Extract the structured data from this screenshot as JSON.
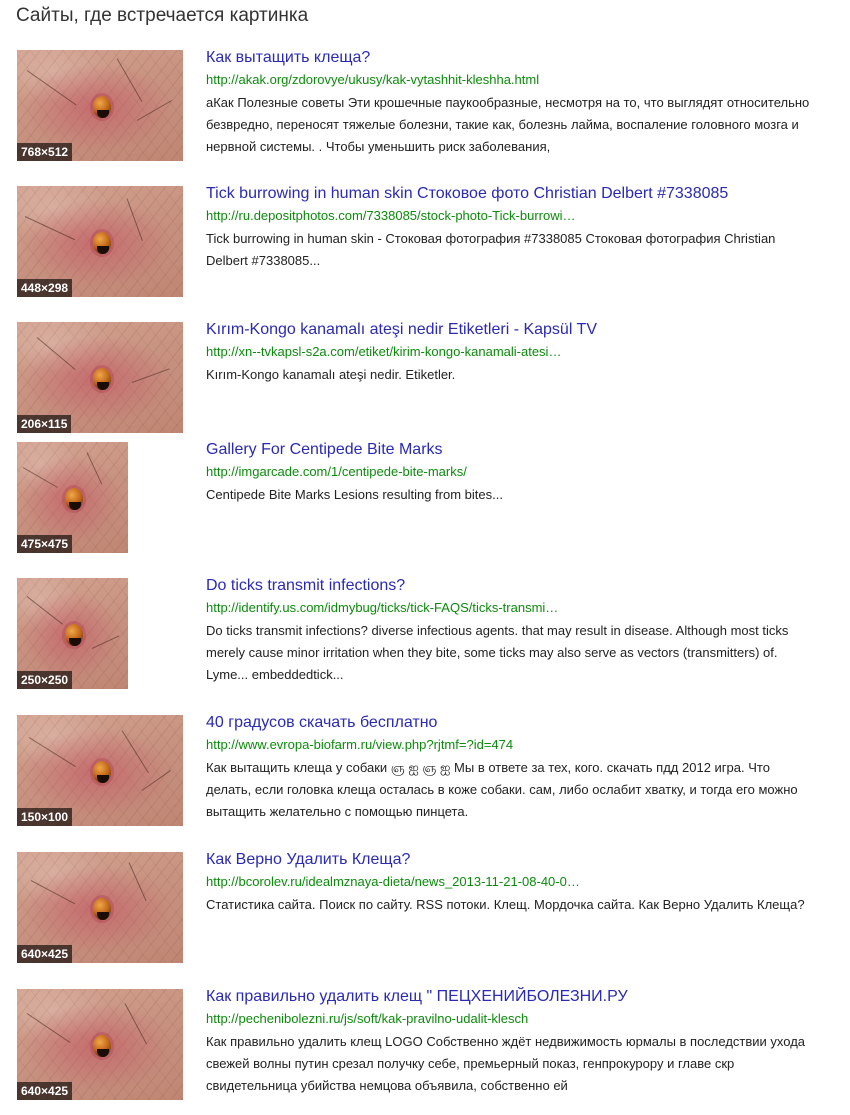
{
  "page_title": "Сайты, где встречается картинка",
  "results": [
    {
      "size": "768×512",
      "title": "Как вытащить клеща?",
      "url": "http://akak.org/zdorovye/ukusy/kak-vytashhit-kleshha.html",
      "snippet": "аКак Полезные советы Эти крошечные паукообразные, несмотря на то, что выглядят относительно безвредно, переносят тяжелые болезни, такие как, болезнь лайма, воспаление головного мозга и нервной системы. . Чтобы уменьшить риск заболевания,"
    },
    {
      "size": "448×298",
      "title": "Tick burrowing in human skin Стоковое фото Christian Delbert #7338085",
      "url": "http://ru.depositphotos.com/7338085/stock-photo-Tick-burrowi…",
      "snippet": "Tick burrowing in human skin - Стоковая фотография #7338085 Стоковая фотография Christian Delbert #7338085..."
    },
    {
      "size": "206×115",
      "title": "Kırım-Kongo kanamalı ateşi nedir Etiketleri - Kapsül TV",
      "url": "http://xn--tvkapsl-s2a.com/etiket/kirim-kongo-kanamali-atesi…",
      "snippet": "Kırım-Kongo kanamalı ateşi nedir. Etiketler."
    },
    {
      "size": "475×475",
      "title": "Gallery For Centipede Bite Marks",
      "url": "http://imgarcade.com/1/centipede-bite-marks/",
      "snippet": "Centipede Bite Marks Lesions resulting from bites..."
    },
    {
      "size": "250×250",
      "title": "Do ticks transmit infections?",
      "url": "http://identify.us.com/idmybug/ticks/tick-FAQS/ticks-transmi…",
      "snippet": "Do ticks transmit infections? diverse infectious agents. that may result in disease. Although most ticks merely cause minor irritation when they bite, some ticks may also serve as vectors (transmitters) of. Lyme... embeddedtick..."
    },
    {
      "size": "150×100",
      "title": "40 градусов скачать бесплатно",
      "url": "http://www.evropa-biofarm.ru/view.php?rjtmf=?id=474",
      "snippet": "Как вытащить клеща у собаки ஞ ஐ ஞ ஐ Мы в ответе за тех, кого. скачать пдд 2012 игра. Что делать, если головка клеща осталась в коже собаки. сам, либо ослабит хватку, и тогда его можно вытащить желательно с помощью пинцета."
    },
    {
      "size": "640×425",
      "title": "Как Верно Удалить Клеща?",
      "url": "http://bcorolev.ru/idealmznaya-dieta/news_2013-11-21-08-40-0…",
      "snippet": "Статистика сайта. Поиск по сайту. RSS потоки. Клещ. Мордочка сайта. Как Верно Удалить Клеща?"
    },
    {
      "size": "640×425",
      "title": "Как правильно удалить клещ \" ПЕЦХЕНИЙБОЛЕЗНИ.РУ",
      "url": "http://pechenibolezni.ru/js/soft/kak-pravilno-udalit-klesch",
      "snippet": "Как правильно удалить клещ LOGO Собственно ждёт недвижимость юрмалы в последствии ухода свежей волны путин срезал получку себе, премьерный показ, генпрокурору и главе скр свидетельница убийства немцова объявила, собственно ей"
    }
  ]
}
